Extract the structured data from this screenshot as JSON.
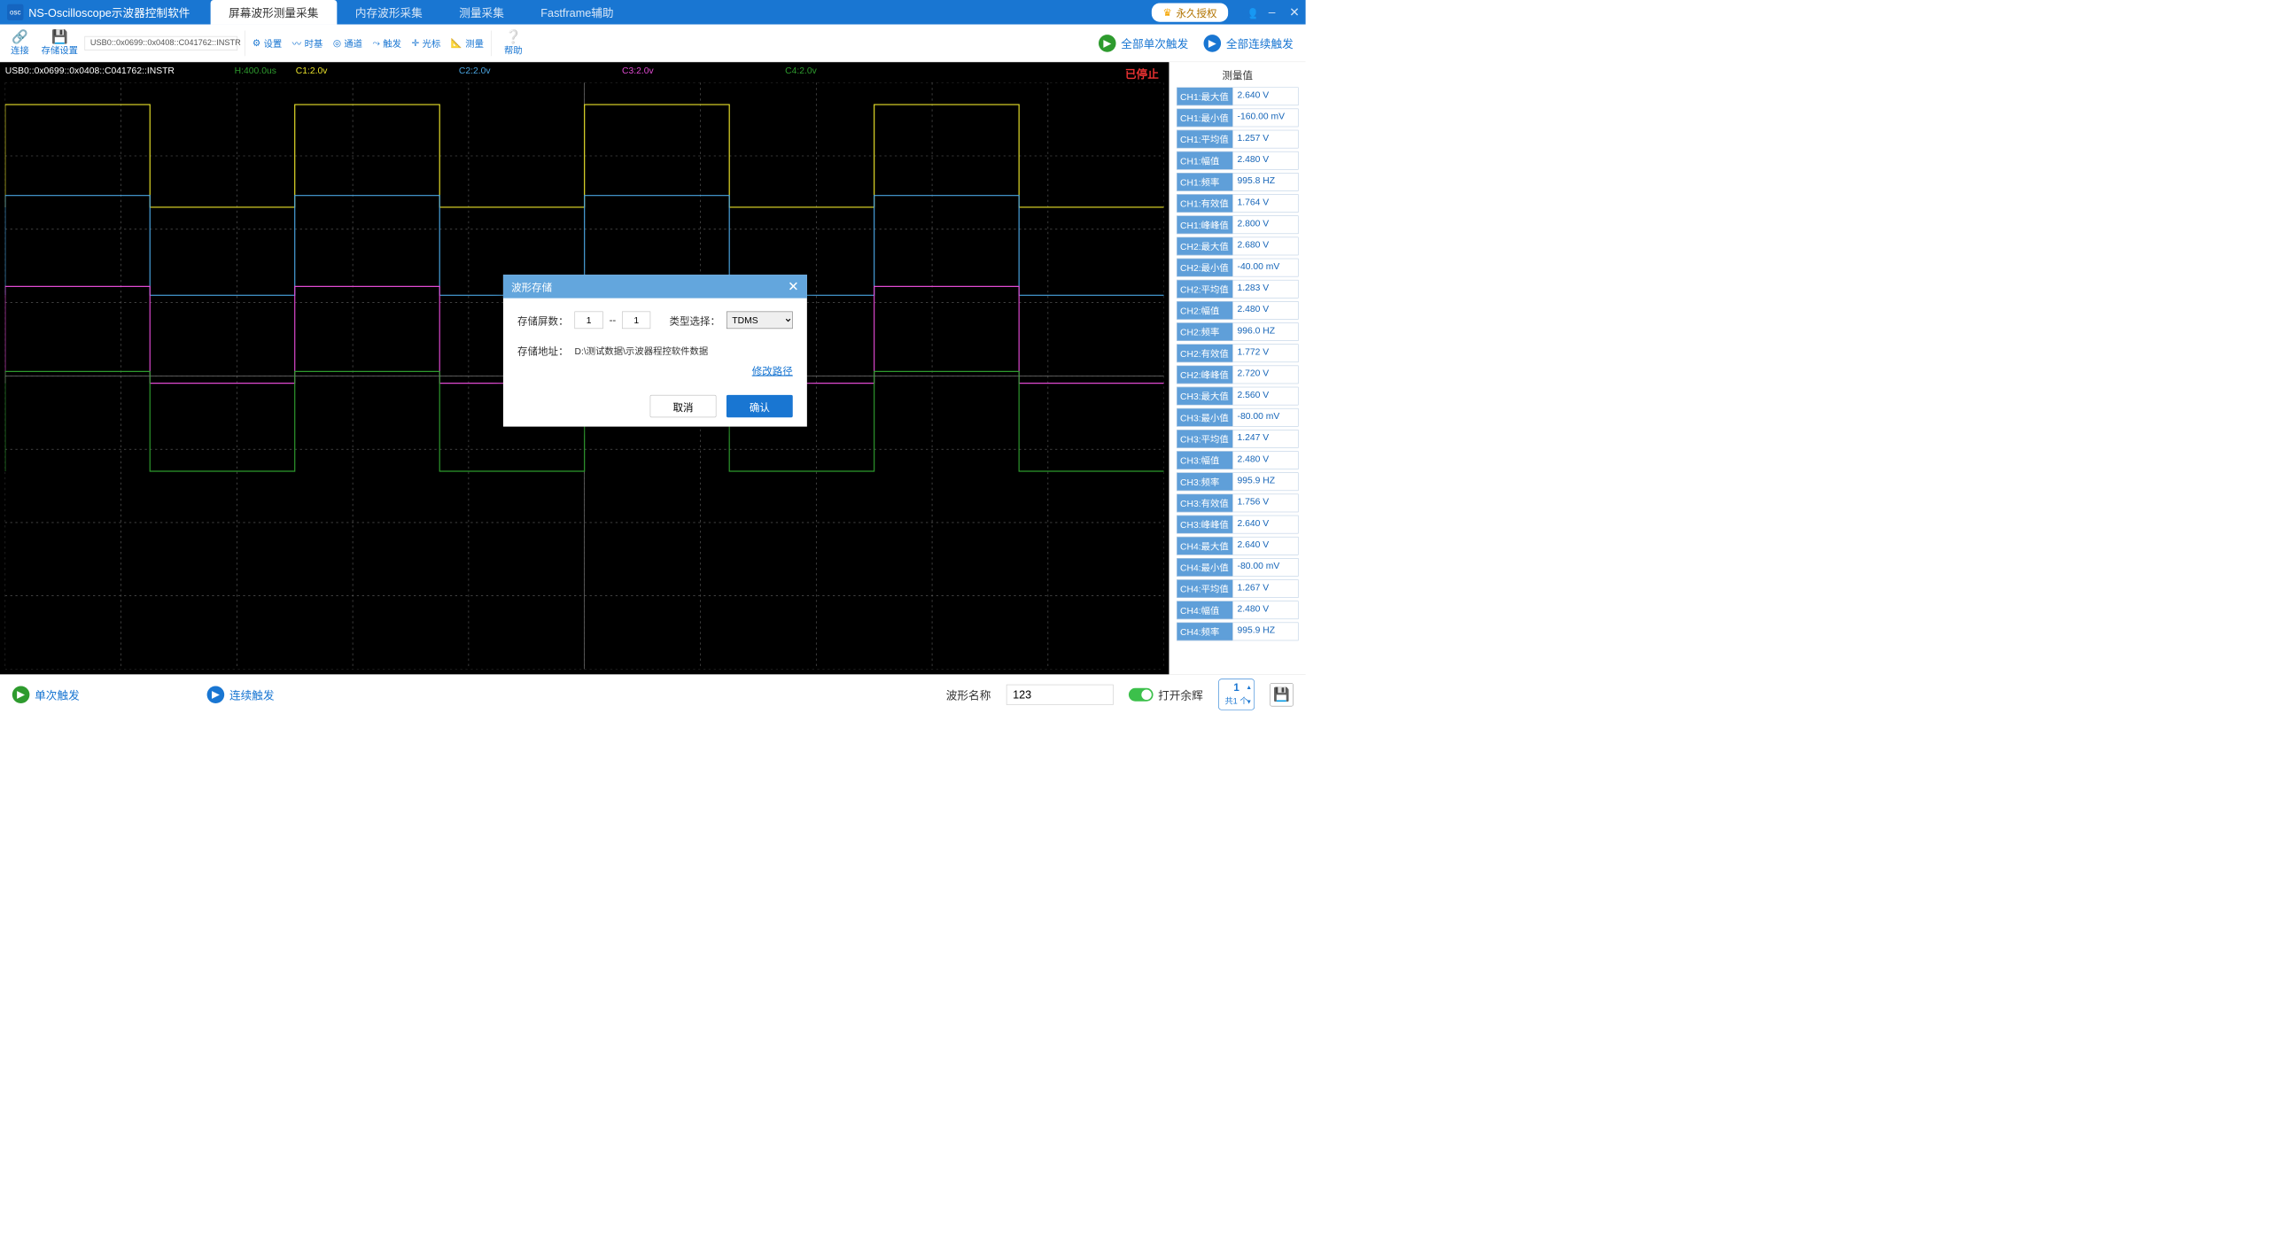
{
  "app": {
    "title": "NS-Oscilloscope示波器控制软件",
    "icon_text": "osc"
  },
  "top_tabs": [
    {
      "label": "屏幕波形测量采集",
      "active": true
    },
    {
      "label": "内存波形采集",
      "active": false
    },
    {
      "label": "测量采集",
      "active": false
    },
    {
      "label": "Fastframe辅助",
      "active": false
    }
  ],
  "license": {
    "label": "永久授权"
  },
  "window_controls": {
    "user_icon": "users-icon",
    "minimize": "–",
    "close": "✕"
  },
  "toolbar": {
    "connect": "连接",
    "save_settings": "存储设置",
    "conn_string": "USB0::0x0699::0x0408::C041762::INSTR",
    "items": [
      {
        "icon": "⚙",
        "label": "设置"
      },
      {
        "icon": "〰",
        "label": "时基"
      },
      {
        "icon": "◎",
        "label": "通道"
      },
      {
        "icon": "⤳",
        "label": "触发"
      },
      {
        "icon": "✛",
        "label": "光标"
      },
      {
        "icon": "📐",
        "label": "测量"
      }
    ],
    "help": "帮助",
    "trigger_all_once": "全部单次触发",
    "trigger_all_cont": "全部连续触发"
  },
  "scope": {
    "conn_text": "USB0::0x0699::0x0408::C041762::INSTR",
    "status": "已停止",
    "timebase": {
      "label": "H:400.0us",
      "color": "#2e9b2e"
    },
    "channels": [
      {
        "id": "C1",
        "label": "C1:2.0v",
        "color": "#e8e12a"
      },
      {
        "id": "C2",
        "label": "C2:2.0v",
        "color": "#4aa4e0"
      },
      {
        "id": "C3",
        "label": "C3:2.0v",
        "color": "#e04ad2"
      },
      {
        "id": "C4",
        "label": "C4:2.0v",
        "color": "#2e9b2e"
      }
    ]
  },
  "side": {
    "title": "测量值",
    "rows": [
      {
        "k": "CH1:最大值",
        "v": "2.640 V"
      },
      {
        "k": "CH1:最小值",
        "v": "-160.00 mV"
      },
      {
        "k": "CH1:平均值",
        "v": "1.257 V"
      },
      {
        "k": "CH1:幅值",
        "v": "2.480 V"
      },
      {
        "k": "CH1:频率",
        "v": "995.8 HZ"
      },
      {
        "k": "CH1:有效值",
        "v": "1.764 V"
      },
      {
        "k": "CH1:峰峰值",
        "v": "2.800 V"
      },
      {
        "k": "CH2:最大值",
        "v": "2.680 V"
      },
      {
        "k": "CH2:最小值",
        "v": "-40.00 mV"
      },
      {
        "k": "CH2:平均值",
        "v": "1.283 V"
      },
      {
        "k": "CH2:幅值",
        "v": "2.480 V"
      },
      {
        "k": "CH2:频率",
        "v": "996.0 HZ"
      },
      {
        "k": "CH2:有效值",
        "v": "1.772 V"
      },
      {
        "k": "CH2:峰峰值",
        "v": "2.720 V"
      },
      {
        "k": "CH3:最大值",
        "v": "2.560 V"
      },
      {
        "k": "CH3:最小值",
        "v": "-80.00 mV"
      },
      {
        "k": "CH3:平均值",
        "v": "1.247 V"
      },
      {
        "k": "CH3:幅值",
        "v": "2.480 V"
      },
      {
        "k": "CH3:频率",
        "v": "995.9 HZ"
      },
      {
        "k": "CH3:有效值",
        "v": "1.756 V"
      },
      {
        "k": "CH3:峰峰值",
        "v": "2.640 V"
      },
      {
        "k": "CH4:最大值",
        "v": "2.640 V"
      },
      {
        "k": "CH4:最小值",
        "v": "-80.00 mV"
      },
      {
        "k": "CH4:平均值",
        "v": "1.267 V"
      },
      {
        "k": "CH4:幅值",
        "v": "2.480 V"
      },
      {
        "k": "CH4:频率",
        "v": "995.9 HZ"
      }
    ]
  },
  "footer": {
    "single": "单次触发",
    "continuous": "连续触发",
    "wave_name_label": "波形名称",
    "wave_name_value": "123",
    "afterglow": "打开余辉",
    "page_current": "1",
    "page_total_prefix": "共1 个"
  },
  "dialog": {
    "title": "波形存储",
    "screens_label": "存储屏数：",
    "screens_from": "1",
    "screens_sep": "--",
    "screens_to": "1",
    "type_label": "类型选择：",
    "type_value": "TDMS",
    "path_label": "存储地址：",
    "path_value": "D:\\测试数据\\示波器程控软件数据",
    "change_path": "修改路径",
    "cancel": "取消",
    "ok": "确认"
  },
  "chart_data": {
    "type": "line",
    "title": "Oscilloscope screen – 4 square-wave channels",
    "timebase_per_div": "400.0 us",
    "vertical_per_div": "2.0 V",
    "x_divisions": 10,
    "y_divisions": 8,
    "series": [
      {
        "name": "C1",
        "color": "#e8e12a",
        "waveform": "square",
        "period_divs": 2.5,
        "duty": 0.5,
        "high_V": 2.64,
        "low_V": -0.16,
        "baseline_div_from_top": 1.7
      },
      {
        "name": "C2",
        "color": "#4aa4e0",
        "waveform": "square",
        "period_divs": 2.5,
        "duty": 0.5,
        "high_V": 2.68,
        "low_V": -0.04,
        "baseline_div_from_top": 2.9
      },
      {
        "name": "C3",
        "color": "#e04ad2",
        "waveform": "square",
        "period_divs": 2.5,
        "duty": 0.5,
        "high_V": 2.56,
        "low_V": -0.08,
        "baseline_div_from_top": 4.1
      },
      {
        "name": "C4",
        "color": "#2e9b2e",
        "waveform": "square",
        "period_divs": 2.5,
        "duty": 0.5,
        "high_V": 2.64,
        "low_V": -0.08,
        "baseline_div_from_top": 5.3
      }
    ]
  }
}
